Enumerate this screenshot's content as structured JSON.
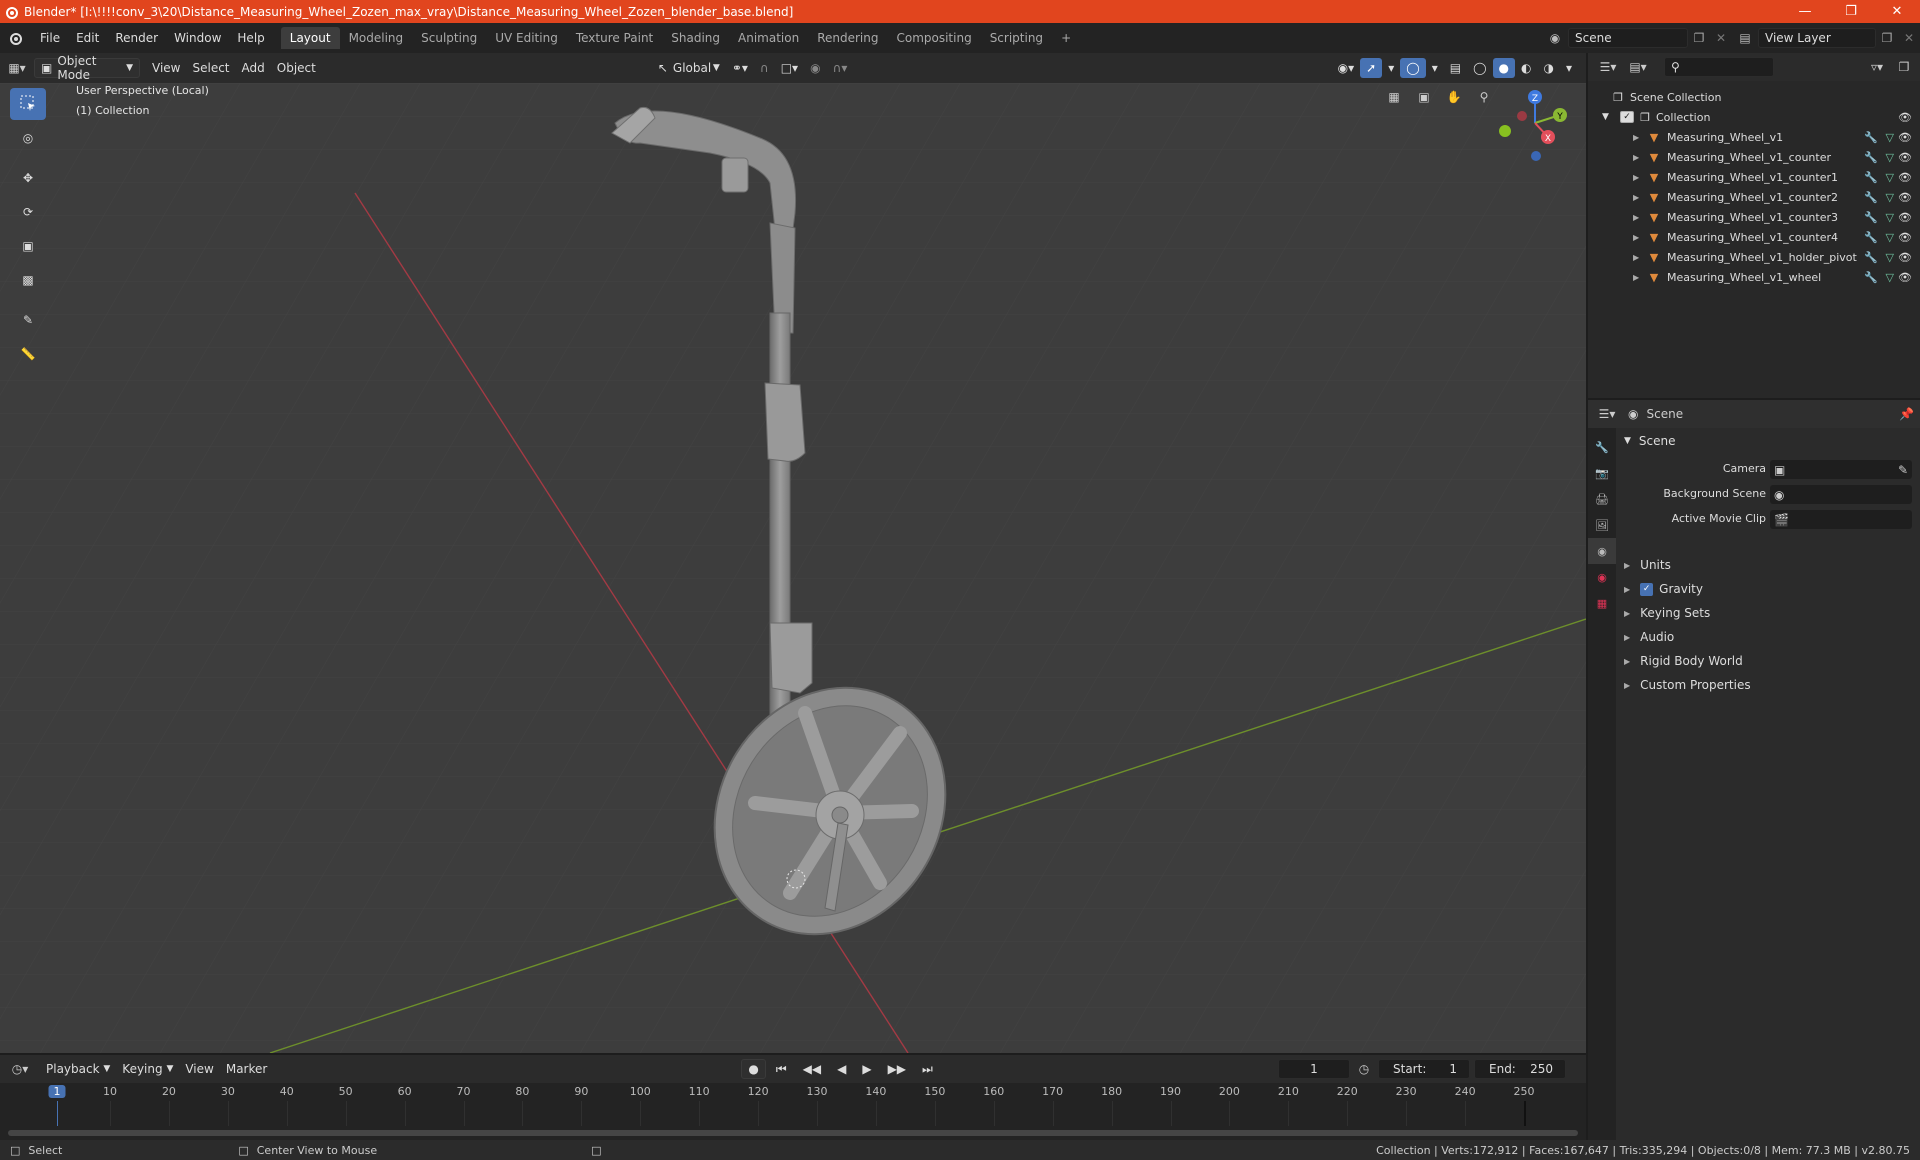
{
  "window": {
    "title": "Blender* [I:\\!!!!conv_3\\20\\Distance_Measuring_Wheel_Zozen_max_vray\\Distance_Measuring_Wheel_Zozen_blender_base.blend]"
  },
  "menu": [
    "File",
    "Edit",
    "Render",
    "Window",
    "Help"
  ],
  "workspaces": [
    "Layout",
    "Modeling",
    "Sculpting",
    "UV Editing",
    "Texture Paint",
    "Shading",
    "Animation",
    "Rendering",
    "Compositing",
    "Scripting"
  ],
  "active_workspace": "Layout",
  "scene_field": "Scene",
  "view_layer_field": "View Layer",
  "viewport_header": {
    "mode": "Object Mode",
    "menus": [
      "View",
      "Select",
      "Add",
      "Object"
    ],
    "transform": "Global"
  },
  "viewport": {
    "perspective": "User Perspective (Local)",
    "collection": "(1) Collection",
    "gizmo": {
      "x": "X",
      "y": "Y",
      "z": "Z"
    }
  },
  "outliner": {
    "root": "Scene Collection",
    "collection": "Collection",
    "items": [
      "Measuring_Wheel_v1",
      "Measuring_Wheel_v1_counter",
      "Measuring_Wheel_v1_counter1",
      "Measuring_Wheel_v1_counter2",
      "Measuring_Wheel_v1_counter3",
      "Measuring_Wheel_v1_counter4",
      "Measuring_Wheel_v1_holder_pivot",
      "Measuring_Wheel_v1_wheel"
    ]
  },
  "properties": {
    "context": "Scene",
    "section": "Scene",
    "fields": [
      {
        "label": "Camera"
      },
      {
        "label": "Background Scene"
      },
      {
        "label": "Active Movie Clip"
      }
    ],
    "panels": [
      "Units",
      "Gravity",
      "Keying Sets",
      "Audio",
      "Rigid Body World",
      "Custom Properties"
    ],
    "gravity_checked": true
  },
  "timeline": {
    "menus": [
      "Playback",
      "Keying",
      "View",
      "Marker"
    ],
    "current_frame": "1",
    "start_label": "Start:",
    "start": "1",
    "end_label": "End:",
    "end": "250",
    "ticks": [
      1,
      10,
      20,
      30,
      40,
      50,
      60,
      70,
      80,
      90,
      100,
      110,
      120,
      130,
      140,
      150,
      160,
      170,
      180,
      190,
      200,
      210,
      220,
      230,
      240,
      250
    ]
  },
  "status": {
    "left": "Select",
    "middle": "Center View to Mouse",
    "right": "Collection | Verts:172,912 | Faces:167,647 | Tris:335,294 | Objects:0/8 | Mem: 77.3 MB | v2.80.75"
  },
  "colors": {
    "accent": "#4772b3",
    "titlebar": "#e1451e",
    "mesh_icon": "#e08a3c",
    "data_icon": "#6fc3a0",
    "x_axis": "#e34f5b",
    "y_axis": "#8ab833",
    "z_axis": "#3f7ae0"
  }
}
